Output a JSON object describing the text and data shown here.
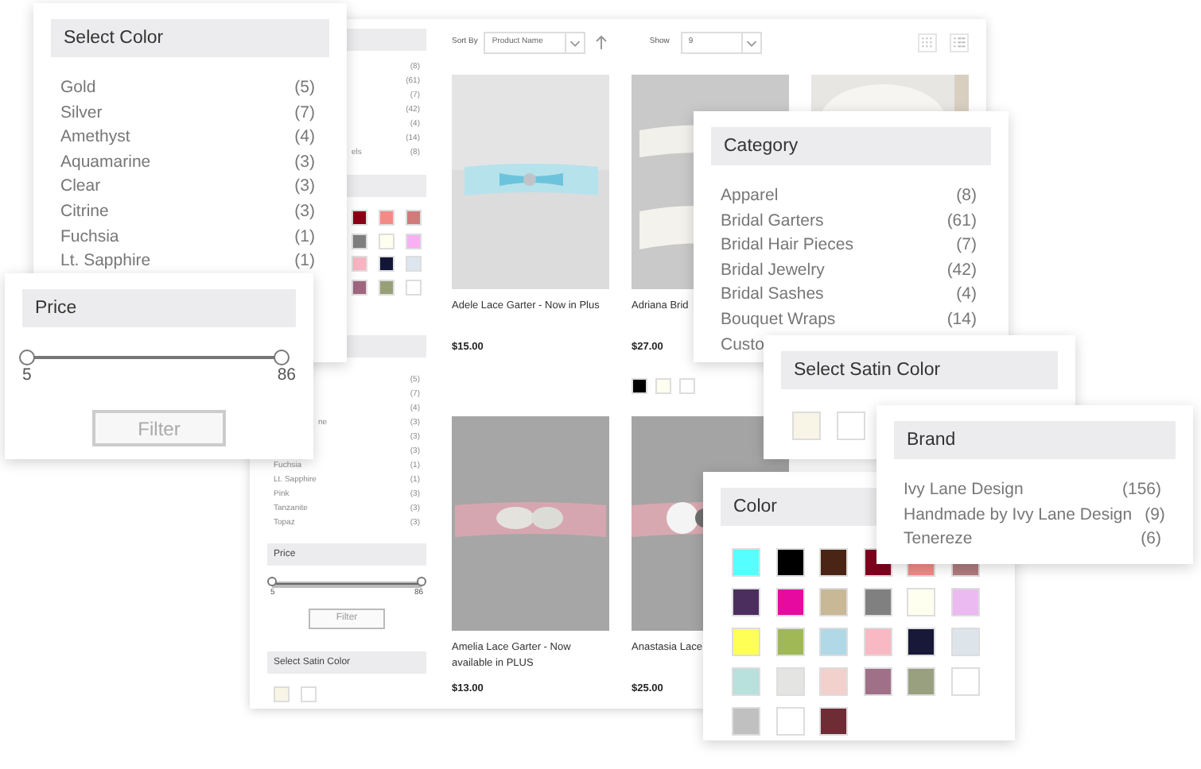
{
  "shop_page": {
    "toolbar": {
      "sort_label": "Sort By",
      "sort_value": "Product Name",
      "show_label": "Show",
      "show_value": "9"
    },
    "sidebar": {
      "category_rows": [
        {
          "count": "(8)"
        },
        {
          "count": "(61)"
        },
        {
          "count": "(7)"
        },
        {
          "count": "(42)"
        },
        {
          "count": "(4)"
        },
        {
          "count": "(14)"
        },
        {
          "label": "els",
          "count": "(8)"
        }
      ],
      "color_swatches": [
        {
          "color": "#8b0016"
        },
        {
          "color": "#f28b86"
        },
        {
          "color": "#d07a7a"
        },
        {
          "color": "#7f7f7f"
        },
        {
          "color": "#fffff0"
        },
        {
          "color": "#f8b0f2"
        },
        {
          "color": "#f8b4c2"
        },
        {
          "color": "#121536"
        },
        {
          "color": "#dde6ee"
        },
        {
          "color": "#a06680"
        },
        {
          "color": "#98a078"
        },
        {
          "color": "#ffffff"
        }
      ],
      "color_rows": [
        {
          "count": "(5)"
        },
        {
          "count": "(7)"
        },
        {
          "count": "(4)"
        },
        {
          "label": "ne",
          "count": "(3)"
        },
        {
          "count": "(3)"
        },
        {
          "count": "(3)"
        },
        {
          "label": "Fuchsia",
          "count": "(1)"
        },
        {
          "label": "Lt. Sapphire",
          "count": "(1)"
        },
        {
          "label": "Pink",
          "count": "(3)"
        },
        {
          "label": "Tanzanite",
          "count": "(3)"
        },
        {
          "label": "Topaz",
          "count": "(3)"
        }
      ],
      "price": {
        "title": "Price",
        "min": "5",
        "max": "86",
        "level": 1,
        "button": "Filter"
      },
      "satin": {
        "title": "Select Satin Color",
        "swatches": [
          {
            "color": "#f8f4e6"
          },
          {
            "color": "#ffffff"
          }
        ]
      }
    },
    "products": [
      {
        "title": "Adele Lace Garter - Now in Plus",
        "price": "$15.00"
      },
      {
        "title": "Adriana Brid",
        "price": "$27.00",
        "swatches": [
          {
            "color": "#000000"
          },
          {
            "color": "#fffff0"
          },
          {
            "color": "#ffffff"
          }
        ]
      },
      {
        "kind": "picture"
      },
      {
        "title": "Amelia Lace Garter - Now available in PLUS",
        "price": "$13.00"
      },
      {
        "title": "Anastasia Lace",
        "price": "$25.00"
      }
    ]
  },
  "panels": [
    {
      "kind": "list",
      "title": "Select Color",
      "items": [
        {
          "label": "Gold",
          "count": "(5)"
        },
        {
          "label": "Silver",
          "count": "(7)"
        },
        {
          "label": "Amethyst",
          "count": "(4)"
        },
        {
          "label": "Aquamarine",
          "count": "(3)"
        },
        {
          "label": "Clear",
          "count": "(3)"
        },
        {
          "label": "Citrine",
          "count": "(3)"
        },
        {
          "label": "Fuchsia",
          "count": "(1)"
        },
        {
          "label": "Lt. Sapphire",
          "count": "(1)"
        }
      ]
    },
    {
      "kind": "price",
      "title": "Price",
      "min": "5",
      "max": "86",
      "level": 1,
      "button": "Filter"
    },
    {
      "kind": "list",
      "title": "Category",
      "items": [
        {
          "label": "Apparel",
          "count": "(8)"
        },
        {
          "label": "Bridal Garters",
          "count": "(61)"
        },
        {
          "label": "Bridal Hair Pieces",
          "count": "(7)"
        },
        {
          "label": "Bridal Jewelry",
          "count": "(42)"
        },
        {
          "label": "Bridal Sashes",
          "count": "(4)"
        },
        {
          "label": "Bouquet Wraps",
          "count": "(14)"
        },
        {
          "label": "Custo"
        }
      ]
    },
    {
      "kind": "swatches",
      "title": "Color",
      "swatches": [
        {
          "color": "#55ffff"
        },
        {
          "color": "#000000"
        },
        {
          "color": "#4a2414"
        },
        {
          "color": "#80001e"
        },
        {
          "color": "#f08a86"
        },
        {
          "color": "#b07a7c"
        },
        {
          "color": "#4b2e5e"
        },
        {
          "color": "#e60aa0"
        },
        {
          "color": "#c8b896"
        },
        {
          "color": "#808080"
        },
        {
          "color": "#fffff0"
        },
        {
          "color": "#ebbaf0"
        },
        {
          "color": "#ffff55"
        },
        {
          "color": "#a0b855"
        },
        {
          "color": "#b0d8e6"
        },
        {
          "color": "#f8b8c4"
        },
        {
          "color": "#181838"
        },
        {
          "color": "#dde4ea"
        },
        {
          "color": "#b8e0dc"
        },
        {
          "color": "#e4e4e2"
        },
        {
          "color": "#f2d0cc"
        },
        {
          "color": "#a07088"
        },
        {
          "color": "#98a080"
        },
        {
          "color": "#ffffff"
        },
        {
          "color": "#c0c0c0"
        },
        {
          "color": "#ffffff"
        },
        {
          "color": "#6e2c34"
        }
      ]
    },
    {
      "kind": "swatches",
      "title": "Select Satin Color",
      "swatches": [
        {
          "color": "#f8f4e6"
        },
        {
          "color": "#ffffff"
        }
      ]
    },
    {
      "kind": "list",
      "title": "Brand",
      "items": [
        {
          "label": "Ivy Lane Design",
          "count": "(156)"
        },
        {
          "label": "Handmade by Ivy Lane Design",
          "count": "(9)"
        },
        {
          "label": "Tenereze",
          "count": "(6)"
        }
      ]
    }
  ]
}
